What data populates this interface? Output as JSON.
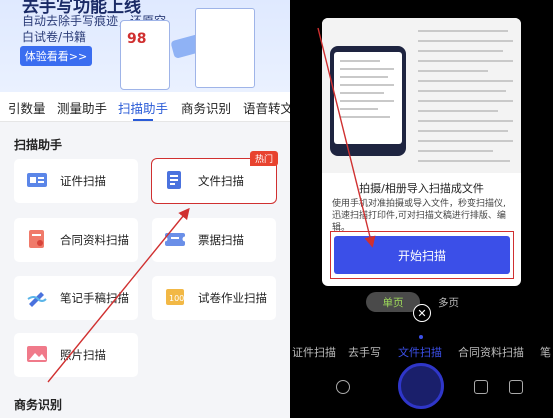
{
  "left": {
    "banner": {
      "title": "去手写功能上线",
      "sub1": "自动去除手写痕迹，还原空",
      "sub2": "白试卷/书籍",
      "cta": "体验看看>>"
    },
    "tabs": [
      "引数量",
      "测量助手",
      "扫描助手",
      "商务识别",
      "语音转文"
    ],
    "active_tab": "扫描助手",
    "section_title": "扫描助手",
    "cards": [
      {
        "label": "证件扫描",
        "icon": "id-card-icon"
      },
      {
        "label": "文件扫描",
        "icon": "document-icon",
        "badge": "热门"
      },
      {
        "label": "合同资料扫描",
        "icon": "contract-icon"
      },
      {
        "label": "票据扫描",
        "icon": "ticket-icon"
      },
      {
        "label": "笔记手稿扫描",
        "icon": "note-pen-icon"
      },
      {
        "label": "试卷作业扫描",
        "icon": "exam-paper-icon"
      },
      {
        "label": "照片扫描",
        "icon": "photo-icon"
      }
    ],
    "section2_title": "商务识别"
  },
  "right": {
    "dialog": {
      "title": "拍摄/相册导入扫描成文件",
      "desc": "使用手机对准拍摄或导入文件，秒变扫描仪,迅速扫描打印件,可对扫描文稿进行排版、编辑。",
      "button": "开始扫描"
    },
    "page_mode": {
      "single": "单页",
      "multi": "多页"
    },
    "modes": [
      "证件扫描",
      "去手写",
      "文件扫描",
      "合同资料扫描",
      "笔"
    ],
    "active_mode": "文件扫描"
  },
  "colors": {
    "accent": "#2a5bd7",
    "button": "#3b4fe8",
    "annotation": "#d03030",
    "badge": "#e8432f"
  }
}
